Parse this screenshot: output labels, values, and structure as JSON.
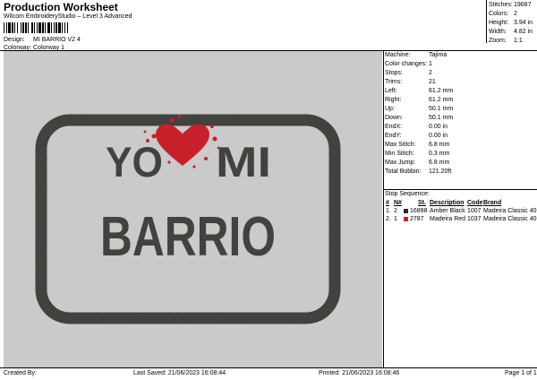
{
  "header": {
    "title": "Production Worksheet",
    "subtitle": "Wilcom EmbroideryStudio – Level 3 Advanced"
  },
  "design_info": {
    "design_label": "Design:",
    "design_value": "MI BARRIO V2 4",
    "colorway_label": "Colorway:",
    "colorway_value": "Colorway 1"
  },
  "summary": [
    {
      "label": "Stitches:",
      "value": "19687"
    },
    {
      "label": "Colors:",
      "value": "2"
    },
    {
      "label": "Height:",
      "value": "3.94 in"
    },
    {
      "label": "Width:",
      "value": "4.82 in"
    },
    {
      "label": "Zoom:",
      "value": "1:1"
    }
  ],
  "artwork": {
    "line1_left": "YO",
    "line1_right": "MI",
    "line2": "BARRIO",
    "colors": {
      "thread_black": "#3e3e3b",
      "thread_red": "#c8202a",
      "background": "#cacaca"
    }
  },
  "machine_details": [
    {
      "label": "Machine:",
      "value": "Tajima"
    },
    {
      "label": "Color changes:",
      "value": "1"
    },
    {
      "label": "Stops:",
      "value": "2"
    },
    {
      "label": "Trims:",
      "value": "21"
    },
    {
      "label": "Left:",
      "value": "61.2 mm"
    },
    {
      "label": "Right:",
      "value": "61.2 mm"
    },
    {
      "label": "Up:",
      "value": "50.1 mm"
    },
    {
      "label": "Down:",
      "value": "50.1 mm"
    },
    {
      "label": "EndX:",
      "value": "0.00 in"
    },
    {
      "label": "EndY:",
      "value": "0.00 in"
    },
    {
      "label": "Max Stitch:",
      "value": "6.8 mm"
    },
    {
      "label": "Min Stitch:",
      "value": "0.3 mm"
    },
    {
      "label": "Max Jump:",
      "value": "6.8 mm"
    },
    {
      "label": "Total Bobbin:",
      "value": "121.20ft"
    }
  ],
  "stop_sequence": {
    "label": "Stop Sequence:",
    "headers": [
      "#",
      "N#",
      "St.",
      "Description",
      "Code",
      "Brand"
    ],
    "rows": [
      {
        "num": "1.",
        "needle": "2",
        "color": "#2b2b2b",
        "stitches": "16898",
        "description": "Amber Black",
        "code": "1007",
        "brand": "Madeira Classic 40"
      },
      {
        "num": "2.",
        "needle": "1",
        "color": "#d11f2a",
        "stitches": "2787",
        "description": "Madeira Red",
        "code": "1037",
        "brand": "Madeira Classic 40"
      }
    ]
  },
  "footer": {
    "created_by": "Created By:",
    "last_saved": "Last Saved: 21/06/2023 16:08:44",
    "printed": "Printed: 21/06/2023 16:08:46",
    "page": "Page 1 of 1"
  }
}
